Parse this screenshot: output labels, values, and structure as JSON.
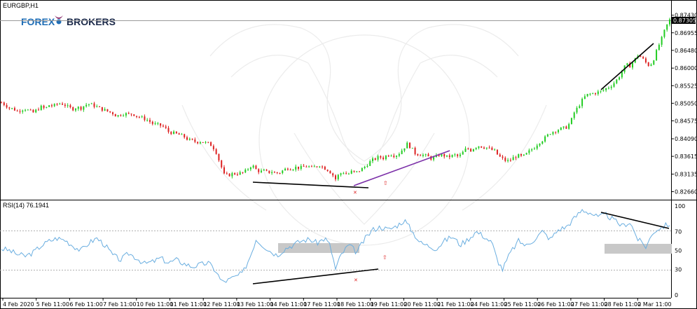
{
  "chart": {
    "symbol_label": "EURGBP,H1",
    "current_price": "0.87305",
    "price_ticks": [
      "0.87430",
      "0.86955",
      "0.86480",
      "0.86000",
      "0.85525",
      "0.85050",
      "0.84575",
      "0.84090",
      "0.83615",
      "0.83135",
      "0.82660"
    ],
    "ohlc_stats": null
  },
  "rsi": {
    "label": "RSI(14) 76.1941",
    "ticks": [
      "100",
      "70",
      "50",
      "30",
      "0"
    ]
  },
  "time_axis": {
    "labels": [
      "4 Feb 2020",
      "5 Feb 11:00",
      "6 Feb 11:00",
      "7 Feb 11:00",
      "10 Feb 11:00",
      "11 Feb 11:00",
      "12 Feb 11:00",
      "13 Feb 11:00",
      "14 Feb 11:00",
      "17 Feb 11:00",
      "18 Feb 11:00",
      "19 Feb 11:00",
      "20 Feb 11:00",
      "21 Feb 11:00",
      "24 Feb 11:00",
      "25 Feb 11:00",
      "26 Feb 11:00",
      "27 Feb 11:00",
      "28 Feb 11:00",
      "2 Mar 11:00"
    ]
  },
  "logo": {
    "part1": "FOREX",
    "part2": "BROKERS"
  },
  "colors": {
    "bull": "#22cc22",
    "bear": "#dd2222",
    "rsi_line": "#6aaee0",
    "trend_black": "#000000",
    "trend_purple": "#7b2fa8",
    "zone": "#c8c8c8",
    "logo_blue": "#1f6db5",
    "logo_dark": "#1c2a4a"
  },
  "chart_data": {
    "type": "candlestick",
    "title": "EURGBP,H1",
    "ylim": [
      0.825,
      0.875
    ],
    "close_path": [
      [
        0,
        0.8507
      ],
      [
        3,
        0.85
      ],
      [
        6,
        0.8492
      ],
      [
        9,
        0.849
      ],
      [
        12,
        0.8483
      ],
      [
        15,
        0.8488
      ],
      [
        18,
        0.849
      ],
      [
        21,
        0.8484
      ],
      [
        24,
        0.848
      ],
      [
        27,
        0.8488
      ],
      [
        30,
        0.8495
      ],
      [
        33,
        0.849
      ],
      [
        36,
        0.85
      ],
      [
        39,
        0.8497
      ],
      [
        42,
        0.8503
      ],
      [
        45,
        0.8505
      ],
      [
        48,
        0.85
      ],
      [
        51,
        0.8493
      ],
      [
        54,
        0.849
      ],
      [
        57,
        0.8494
      ],
      [
        60,
        0.8492
      ],
      [
        63,
        0.85
      ],
      [
        66,
        0.8503
      ],
      [
        69,
        0.85
      ],
      [
        72,
        0.8495
      ],
      [
        75,
        0.849
      ],
      [
        78,
        0.8486
      ],
      [
        81,
        0.8482
      ],
      [
        84,
        0.8478
      ],
      [
        87,
        0.847
      ],
      [
        90,
        0.8475
      ],
      [
        93,
        0.8477
      ],
      [
        96,
        0.8475
      ],
      [
        99,
        0.8477
      ],
      [
        102,
        0.847
      ],
      [
        105,
        0.8467
      ],
      [
        108,
        0.8463
      ],
      [
        111,
        0.8458
      ],
      [
        114,
        0.845
      ],
      [
        117,
        0.8447
      ],
      [
        120,
        0.8445
      ],
      [
        123,
        0.844
      ],
      [
        126,
        0.8428
      ],
      [
        129,
        0.8425
      ],
      [
        132,
        0.8422
      ],
      [
        135,
        0.8419
      ],
      [
        138,
        0.8414
      ],
      [
        141,
        0.8406
      ],
      [
        144,
        0.8404
      ],
      [
        147,
        0.84
      ],
      [
        150,
        0.8402
      ],
      [
        153,
        0.8399
      ],
      [
        156,
        0.8396
      ],
      [
        159,
        0.839
      ],
      [
        162,
        0.8372
      ],
      [
        165,
        0.8342
      ],
      [
        168,
        0.8312
      ],
      [
        171,
        0.831
      ],
      [
        174,
        0.8314
      ],
      [
        177,
        0.8315
      ],
      [
        180,
        0.8316
      ],
      [
        183,
        0.8318
      ],
      [
        186,
        0.8328
      ],
      [
        189,
        0.8338
      ],
      [
        192,
        0.8326
      ],
      [
        195,
        0.832
      ],
      [
        198,
        0.8322
      ],
      [
        201,
        0.8318
      ],
      [
        204,
        0.832
      ],
      [
        207,
        0.8316
      ],
      [
        210,
        0.8318
      ],
      [
        213,
        0.8325
      ],
      [
        216,
        0.833
      ],
      [
        219,
        0.8328
      ],
      [
        222,
        0.8332
      ],
      [
        225,
        0.833
      ],
      [
        228,
        0.8333
      ],
      [
        231,
        0.8335
      ],
      [
        234,
        0.833
      ],
      [
        237,
        0.8334
      ],
      [
        240,
        0.8338
      ],
      [
        243,
        0.8331
      ],
      [
        246,
        0.8325
      ],
      [
        249,
        0.8316
      ],
      [
        252,
        0.83
      ],
      [
        255,
        0.8315
      ],
      [
        258,
        0.8318
      ],
      [
        261,
        0.8312
      ],
      [
        264,
        0.832
      ],
      [
        267,
        0.8317
      ],
      [
        270,
        0.8323
      ],
      [
        273,
        0.833
      ],
      [
        276,
        0.834
      ],
      [
        279,
        0.835
      ],
      [
        282,
        0.8355
      ],
      [
        285,
        0.836
      ],
      [
        288,
        0.8357
      ],
      [
        291,
        0.8365
      ],
      [
        294,
        0.8367
      ],
      [
        297,
        0.8363
      ],
      [
        300,
        0.837
      ],
      [
        303,
        0.8382
      ],
      [
        306,
        0.8395
      ],
      [
        309,
        0.8385
      ],
      [
        312,
        0.837
      ],
      [
        315,
        0.8367
      ],
      [
        318,
        0.8365
      ],
      [
        321,
        0.8362
      ],
      [
        324,
        0.8356
      ],
      [
        327,
        0.8358
      ],
      [
        330,
        0.8365
      ],
      [
        333,
        0.8365
      ],
      [
        336,
        0.836
      ],
      [
        339,
        0.8362
      ],
      [
        342,
        0.8365
      ],
      [
        345,
        0.836
      ],
      [
        348,
        0.8372
      ],
      [
        351,
        0.8384
      ],
      [
        354,
        0.8378
      ],
      [
        357,
        0.8386
      ],
      [
        360,
        0.839
      ],
      [
        363,
        0.8387
      ],
      [
        366,
        0.8385
      ],
      [
        369,
        0.838
      ],
      [
        372,
        0.8376
      ],
      [
        375,
        0.8362
      ],
      [
        378,
        0.8355
      ],
      [
        381,
        0.8348
      ],
      [
        384,
        0.8352
      ],
      [
        387,
        0.836
      ],
      [
        390,
        0.8363
      ],
      [
        393,
        0.836
      ],
      [
        396,
        0.8368
      ],
      [
        399,
        0.8378
      ],
      [
        402,
        0.8386
      ],
      [
        405,
        0.8398
      ],
      [
        408,
        0.8405
      ],
      [
        411,
        0.8415
      ],
      [
        414,
        0.8425
      ],
      [
        417,
        0.843
      ],
      [
        420,
        0.8434
      ],
      [
        423,
        0.8437
      ],
      [
        426,
        0.844
      ],
      [
        429,
        0.8452
      ],
      [
        432,
        0.848
      ],
      [
        435,
        0.8495
      ],
      [
        438,
        0.8513
      ],
      [
        441,
        0.8527
      ],
      [
        444,
        0.853
      ],
      [
        447,
        0.8532
      ],
      [
        450,
        0.8535
      ],
      [
        453,
        0.8538
      ],
      [
        456,
        0.8545
      ],
      [
        459,
        0.855
      ],
      [
        462,
        0.856
      ],
      [
        465,
        0.8572
      ],
      [
        468,
        0.859
      ],
      [
        471,
        0.861
      ],
      [
        474,
        0.8606
      ],
      [
        477,
        0.862
      ],
      [
        480,
        0.8635
      ],
      [
        483,
        0.8628
      ],
      [
        486,
        0.8615
      ],
      [
        489,
        0.8605
      ],
      [
        492,
        0.8625
      ],
      [
        495,
        0.8655
      ],
      [
        498,
        0.868
      ],
      [
        501,
        0.871
      ],
      [
        504,
        0.873
      ]
    ],
    "rsi_path": [
      [
        0,
        52
      ],
      [
        6,
        50
      ],
      [
        12,
        46
      ],
      [
        18,
        44
      ],
      [
        24,
        48
      ],
      [
        30,
        55
      ],
      [
        36,
        60
      ],
      [
        42,
        63
      ],
      [
        48,
        61
      ],
      [
        54,
        55
      ],
      [
        60,
        50
      ],
      [
        66,
        58
      ],
      [
        72,
        63
      ],
      [
        78,
        56
      ],
      [
        84,
        45
      ],
      [
        90,
        40
      ],
      [
        96,
        47
      ],
      [
        102,
        42
      ],
      [
        108,
        36
      ],
      [
        114,
        38
      ],
      [
        120,
        42
      ],
      [
        126,
        37
      ],
      [
        132,
        40
      ],
      [
        138,
        36
      ],
      [
        144,
        33
      ],
      [
        150,
        35
      ],
      [
        156,
        37
      ],
      [
        162,
        28
      ],
      [
        166,
        17
      ],
      [
        170,
        18
      ],
      [
        176,
        22
      ],
      [
        182,
        26
      ],
      [
        188,
        45
      ],
      [
        192,
        62
      ],
      [
        196,
        57
      ],
      [
        202,
        50
      ],
      [
        208,
        45
      ],
      [
        214,
        52
      ],
      [
        220,
        56
      ],
      [
        226,
        60
      ],
      [
        232,
        62
      ],
      [
        238,
        58
      ],
      [
        244,
        63
      ],
      [
        248,
        55
      ],
      [
        252,
        30
      ],
      [
        256,
        45
      ],
      [
        262,
        56
      ],
      [
        268,
        48
      ],
      [
        274,
        62
      ],
      [
        280,
        72
      ],
      [
        286,
        75
      ],
      [
        292,
        72
      ],
      [
        298,
        76
      ],
      [
        304,
        82
      ],
      [
        310,
        70
      ],
      [
        316,
        58
      ],
      [
        322,
        55
      ],
      [
        328,
        52
      ],
      [
        334,
        60
      ],
      [
        340,
        65
      ],
      [
        346,
        56
      ],
      [
        352,
        62
      ],
      [
        358,
        70
      ],
      [
        364,
        65
      ],
      [
        370,
        58
      ],
      [
        374,
        40
      ],
      [
        378,
        30
      ],
      [
        384,
        48
      ],
      [
        390,
        60
      ],
      [
        396,
        55
      ],
      [
        402,
        62
      ],
      [
        408,
        70
      ],
      [
        414,
        62
      ],
      [
        420,
        72
      ],
      [
        426,
        75
      ],
      [
        432,
        84
      ],
      [
        438,
        93
      ],
      [
        444,
        90
      ],
      [
        450,
        85
      ],
      [
        456,
        88
      ],
      [
        462,
        82
      ],
      [
        468,
        76
      ],
      [
        474,
        80
      ],
      [
        480,
        62
      ],
      [
        486,
        54
      ],
      [
        492,
        70
      ],
      [
        498,
        75
      ],
      [
        504,
        78
      ]
    ]
  }
}
